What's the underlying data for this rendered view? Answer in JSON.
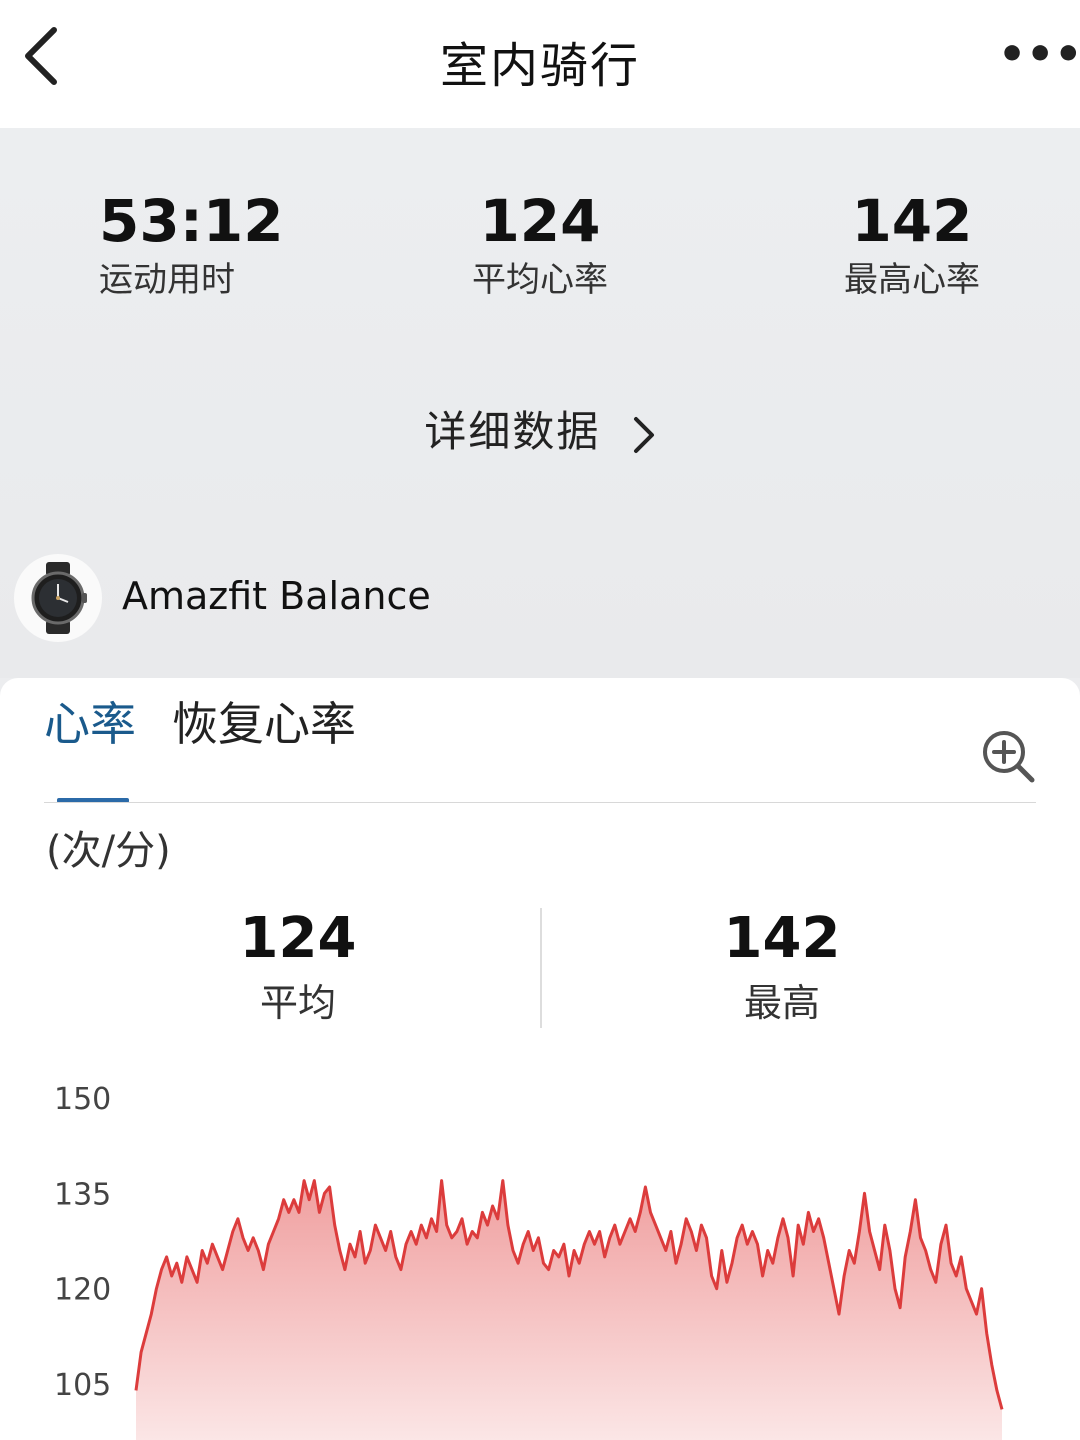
{
  "header": {
    "title": "室内骑行",
    "back_icon": "chevron-left-icon",
    "more_label": "•••"
  },
  "summary": {
    "duration": {
      "value": "53:12",
      "label": "运动用时"
    },
    "avg_hr": {
      "value": "124",
      "label": "平均心率"
    },
    "max_hr": {
      "value": "142",
      "label": "最高心率"
    },
    "detail_link": "详细数据"
  },
  "device": {
    "name": "Amazfit Balance",
    "icon": "watch-icon"
  },
  "heart_card": {
    "tabs": [
      {
        "label": "心率",
        "active": true
      },
      {
        "label": "恢复心率",
        "active": false
      }
    ],
    "unit": "(次/分)",
    "avg": {
      "value": "124",
      "label": "平均"
    },
    "max": {
      "value": "142",
      "label": "最高"
    },
    "zoom_icon": "zoom-in-icon"
  },
  "colors": {
    "accent_blue": "#1a5a8c",
    "line_red": "#dc3c3c",
    "fill_red": "#ef9a9a"
  },
  "chart_data": {
    "type": "area",
    "title": "",
    "xlabel": "",
    "ylabel": "",
    "y_ticks": [
      150,
      135,
      120,
      105
    ],
    "ylim": [
      105,
      150
    ],
    "grid": false,
    "series": [
      {
        "values": [
          104,
          110,
          113,
          116,
          120,
          123,
          125,
          122,
          124,
          121,
          125,
          123,
          121,
          126,
          124,
          127,
          125,
          123,
          126,
          129,
          131,
          128,
          126,
          128,
          126,
          123,
          127,
          129,
          131,
          134,
          132,
          134,
          132,
          137,
          134,
          137,
          132,
          135,
          136,
          130,
          126,
          123,
          127,
          125,
          129,
          124,
          126,
          130,
          128,
          126,
          129,
          125,
          123,
          127,
          129,
          127,
          130,
          128,
          131,
          129,
          137,
          130,
          128,
          129,
          131,
          127,
          129,
          128,
          132,
          130,
          133,
          131,
          137,
          130,
          126,
          124,
          127,
          129,
          126,
          128,
          124,
          123,
          126,
          125,
          127,
          122,
          126,
          124,
          127,
          129,
          127,
          129,
          125,
          128,
          130,
          127,
          129,
          131,
          129,
          132,
          136,
          132,
          130,
          128,
          126,
          129,
          124,
          127,
          131,
          129,
          126,
          130,
          128,
          122,
          120,
          126,
          121,
          124,
          128,
          130,
          127,
          129,
          127,
          122,
          126,
          124,
          128,
          131,
          128,
          122,
          130,
          127,
          132,
          129,
          131,
          128,
          124,
          120,
          116,
          122,
          126,
          124,
          129,
          135,
          129,
          126,
          123,
          130,
          126,
          120,
          117,
          125,
          129,
          134,
          128,
          126,
          123,
          121,
          127,
          130,
          124,
          122,
          125,
          120,
          118,
          116,
          120,
          113,
          108,
          104,
          101
        ]
      }
    ]
  }
}
